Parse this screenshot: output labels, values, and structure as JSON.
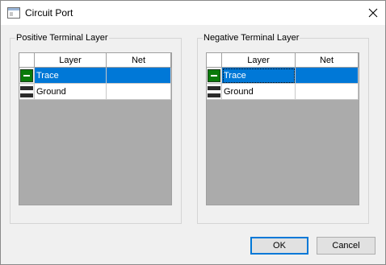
{
  "window": {
    "title": "Circuit Port"
  },
  "positive_group": {
    "legend": "Positive Terminal Layer",
    "columns": [
      "Layer",
      "Net"
    ],
    "rows": [
      {
        "layer": "Trace",
        "net": "",
        "swatch": "trace-layer-swatch-icon",
        "selected": true
      },
      {
        "layer": "Ground",
        "net": "",
        "swatch": "ground-layer-swatch-icon",
        "selected": false
      }
    ]
  },
  "negative_group": {
    "legend": "Negative Terminal Layer",
    "columns": [
      "Layer",
      "Net"
    ],
    "rows": [
      {
        "layer": "Trace",
        "net": "",
        "swatch": "trace-layer-swatch-icon",
        "selected": true
      },
      {
        "layer": "Ground",
        "net": "",
        "swatch": "ground-layer-swatch-icon",
        "selected": false
      }
    ]
  },
  "buttons": {
    "ok": "OK",
    "cancel": "Cancel"
  },
  "colors": {
    "selection": "#0078d7",
    "trace_swatch": "#0a7a0a",
    "ground_swatch": "#2b2b2b",
    "dialog_bg": "#f0f0f0"
  }
}
